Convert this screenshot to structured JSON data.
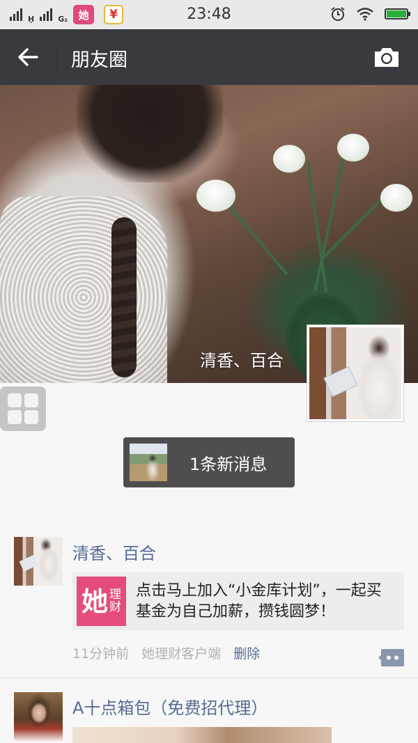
{
  "status_bar": {
    "network_1": "Ḥ",
    "network_2": "G₂",
    "app_badge_1": "她",
    "app_badge_2": "¥",
    "time": "23:48",
    "battery_color": "#2ab03a"
  },
  "nav": {
    "title": "朋友圈",
    "back_icon": "arrow-left-icon",
    "camera_icon": "camera-icon",
    "bg_color": "#393a3f"
  },
  "cover": {
    "user_name": "清香、百合"
  },
  "new_messages": {
    "label": "1条新消息"
  },
  "feed": [
    {
      "author": "清香、百合",
      "share": {
        "icon_char": "她",
        "icon_sub_1": "理",
        "icon_sub_2": "财",
        "text": "点击马上加入“小金库计划”，一起买基金为自己加薪，攒钱圆梦！"
      },
      "time": "11分钟前",
      "source": "她理财客户端",
      "delete_label": "删除"
    },
    {
      "author": "A十点箱包（免费招代理）"
    }
  ],
  "colors": {
    "link": "#576b95",
    "meta": "#b2b2b2",
    "share_icon_bg": "#e44d7b"
  }
}
